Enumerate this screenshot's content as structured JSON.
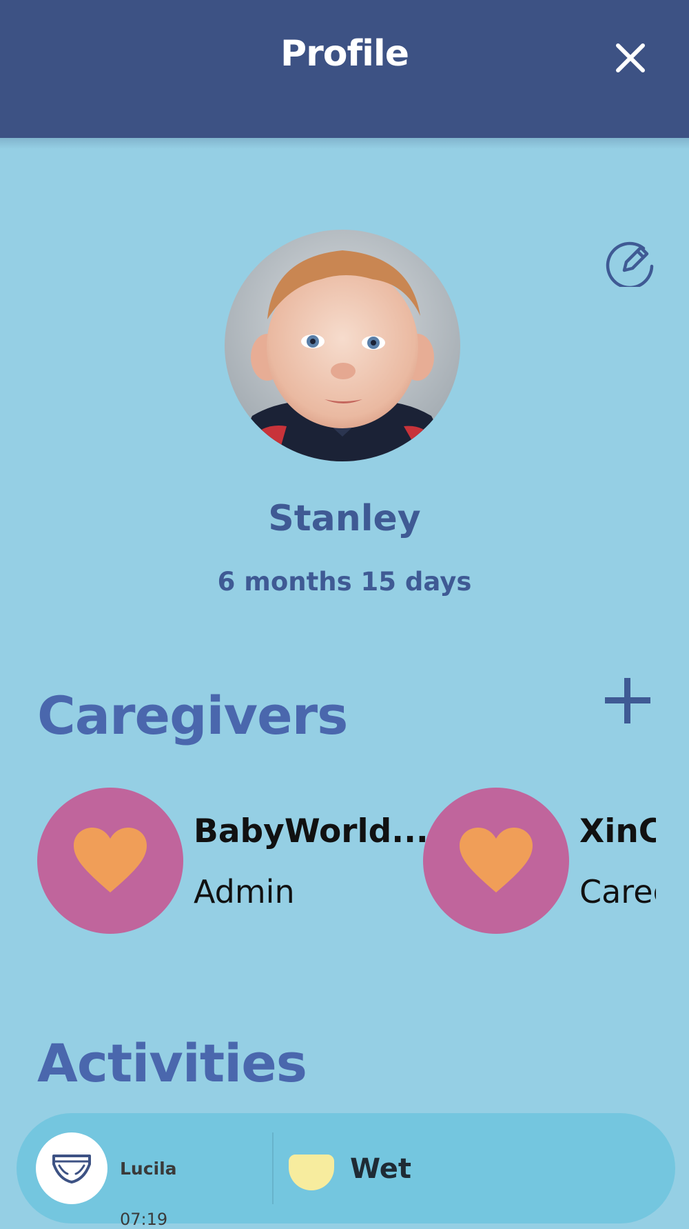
{
  "header": {
    "title": "Profile"
  },
  "child": {
    "name": "Stanley",
    "age": "6 months 15 days"
  },
  "caregivers": {
    "title": "Caregivers",
    "items": [
      {
        "name": "BabyWorld...",
        "role": "Admin"
      },
      {
        "name": "XinCh",
        "role": "Caregiver"
      }
    ]
  },
  "activities": {
    "title": "Activities",
    "items": [
      {
        "user": "Lucila",
        "time": "07:19",
        "type": "Wet",
        "icon": "diaper-icon"
      }
    ]
  },
  "colors": {
    "header_bg": "#3d5284",
    "page_bg": "#95cfe4",
    "accent_text": "#4a67ad",
    "caregiver_avatar_bg": "#c0659c",
    "heart": "#f09e58",
    "activity_card_bg": "#74c6df",
    "wet_indicator": "#f7ec9e"
  }
}
